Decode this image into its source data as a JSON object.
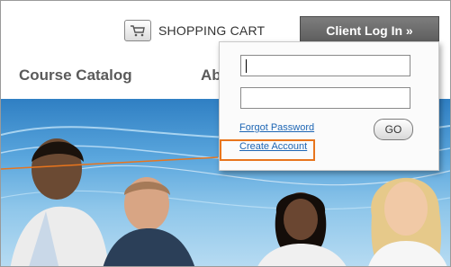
{
  "header": {
    "cart_label": "SHOPPING CART",
    "login_label": "Client Log In »"
  },
  "nav": {
    "items": [
      {
        "label": "Course Catalog"
      },
      {
        "label": "About"
      }
    ]
  },
  "login_panel": {
    "username_value": "",
    "password_value": "",
    "forgot_label": "Forgot Password",
    "create_label": "Create Account",
    "go_label": "GO"
  },
  "colors": {
    "accent_orange": "#e8751d",
    "link_blue": "#1e66b4",
    "button_gray": "#6b6b6b"
  },
  "icons": {
    "cart": "shopping-cart-icon"
  }
}
